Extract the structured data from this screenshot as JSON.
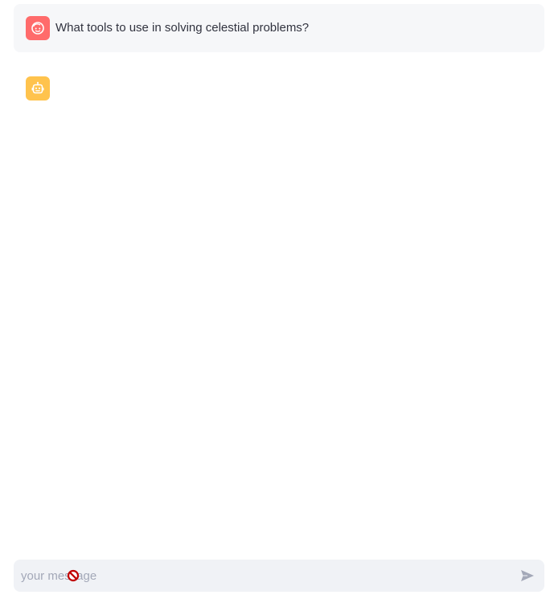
{
  "messages": [
    {
      "role": "user",
      "avatar_icon": "face-icon",
      "text": "What tools to use in solving celestial problems?"
    },
    {
      "role": "assistant",
      "avatar_icon": "robot-icon",
      "text": ""
    }
  ],
  "chat_input": {
    "placeholder": "your message",
    "value": ""
  },
  "send_icon": "send-icon",
  "cursor_icon": "not-allowed-cursor-icon",
  "colors": {
    "user_avatar": "#ff6b6b",
    "assistant_avatar": "#ffc34d",
    "user_message_bg": "#f6f7f9",
    "input_bg": "#f0f2f6",
    "placeholder": "#a3a8b8"
  }
}
